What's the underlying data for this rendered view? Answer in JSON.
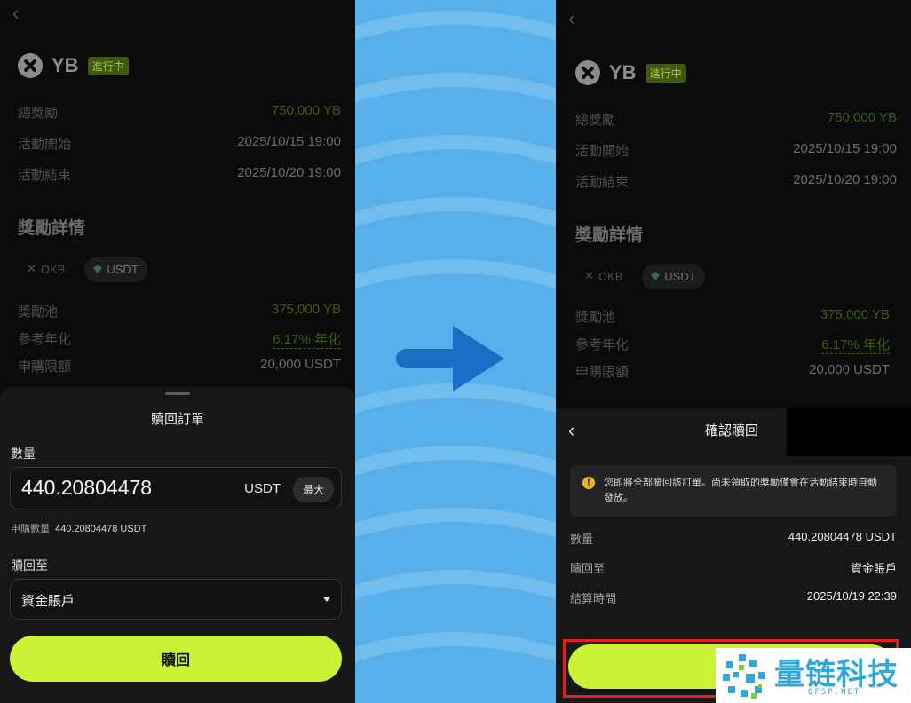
{
  "left": {
    "back_glyph": "‹",
    "token": {
      "name": "YB",
      "status": "進行中"
    },
    "info": [
      {
        "label": "總獎勵",
        "value": "750,000 YB"
      },
      {
        "label": "活動開始",
        "value": "2025/10/15 19:00"
      },
      {
        "label": "活動結束",
        "value": "2025/10/20 19:00"
      }
    ],
    "reward_title": "獎勵詳情",
    "tabs": [
      "OKB",
      "USDT"
    ],
    "reward_info": [
      {
        "label": "獎勵池",
        "value": "375,000 YB"
      },
      {
        "label": "參考年化",
        "value": "6.17% 年化"
      },
      {
        "label": "申購限額",
        "value": "20,000 USDT"
      }
    ],
    "sheet": {
      "title": "贖回訂單",
      "quantity_label": "數量",
      "quantity_value": "440.20804478",
      "unit": "USDT",
      "max_label": "最大",
      "subscribed_label": "申購數量",
      "subscribed_value": "440.20804478 USDT",
      "redeem_to_label": "贖回至",
      "redeem_to_value": "資金賬戶",
      "redeem_button": "贖回"
    }
  },
  "right": {
    "back_glyph": "‹",
    "token": {
      "name": "YB",
      "status": "進行中"
    },
    "info": [
      {
        "label": "總獎勵",
        "value": "750,000 YB"
      },
      {
        "label": "活動開始",
        "value": "2025/10/15 19:00"
      },
      {
        "label": "活動結束",
        "value": "2025/10/20 19:00"
      }
    ],
    "reward_title": "獎勵詳情",
    "tabs": [
      "OKB",
      "USDT"
    ],
    "reward_info": [
      {
        "label": "獎勵池",
        "value": "375,000 YB"
      },
      {
        "label": "參考年化",
        "value": "6.17% 年化"
      },
      {
        "label": "申購限額",
        "value": "20,000 USDT"
      }
    ],
    "confirm": {
      "back_glyph": "‹",
      "title": "確認贖回",
      "notice": "您即將全部贖回該訂單。尚未領取的獎勵僅會在活動結束時自動發放。",
      "rows": [
        {
          "label": "數量",
          "value": "440.20804478 USDT"
        },
        {
          "label": "贖回至",
          "value": "資金賬戶"
        },
        {
          "label": "結算時間",
          "value": "2025/10/19 22:39"
        }
      ]
    }
  },
  "watermark": {
    "name": "量链科技",
    "domain": "QFSP.NET"
  },
  "colors": {
    "accent": "#c9f234",
    "background": "#0b0b0b",
    "highlight_frame": "#e02020",
    "arrow": "#1a6fc4"
  }
}
